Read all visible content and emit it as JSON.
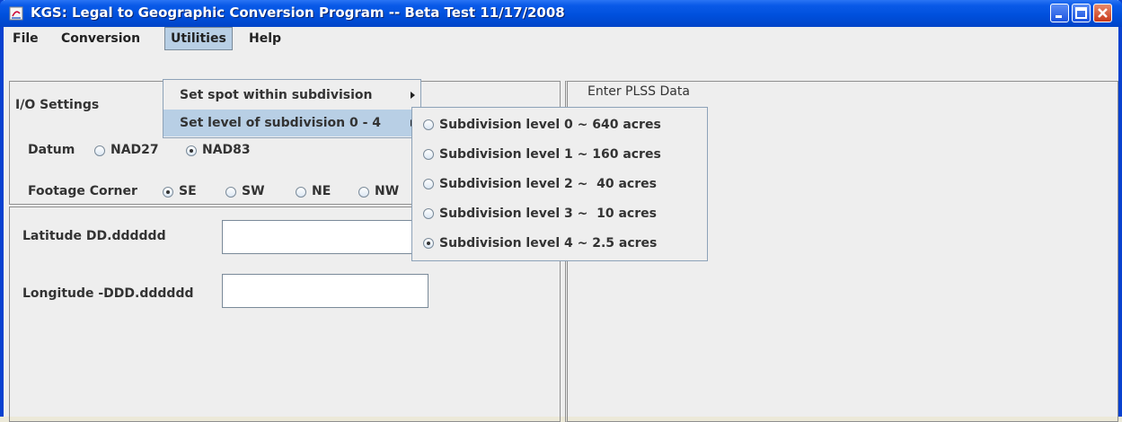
{
  "window": {
    "title": "KGS: Legal to Geographic Conversion Program -- Beta Test 11/17/2008"
  },
  "menubar": {
    "file": "File",
    "conversion": "Conversion",
    "utilities": "Utilities",
    "help": "Help"
  },
  "utilities_menu": {
    "set_spot": "Set spot within subdivision",
    "set_level": "Set level of subdivision 0 - 4"
  },
  "subdivision_menu": {
    "items": [
      {
        "label": "Subdivision level 0 ~ 640 acres",
        "selected": false
      },
      {
        "label": "Subdivision level 1 ~ 160 acres",
        "selected": false
      },
      {
        "label": "Subdivision level 2 ~  40 acres",
        "selected": false
      },
      {
        "label": "Subdivision level 3 ~  10 acres",
        "selected": false
      },
      {
        "label": "Subdivision level 4 ~ 2.5 acres",
        "selected": true
      }
    ]
  },
  "io_settings": {
    "title": "I/O Settings",
    "datum_label": "Datum",
    "datum_options": [
      {
        "label": "NAD27",
        "selected": false
      },
      {
        "label": "NAD83",
        "selected": true
      }
    ],
    "footage_label": "Footage Corner",
    "footage_options": [
      {
        "label": "SE",
        "selected": true
      },
      {
        "label": "SW",
        "selected": false
      },
      {
        "label": "NE",
        "selected": false
      },
      {
        "label": "NW",
        "selected": false
      }
    ]
  },
  "coordinates": {
    "latitude_label": "Latitude   DD.dddddd",
    "latitude_value": "",
    "longitude_label": "Longitude -DDD.dddddd",
    "longitude_value": ""
  },
  "plss": {
    "title": "Enter PLSS Data"
  }
}
